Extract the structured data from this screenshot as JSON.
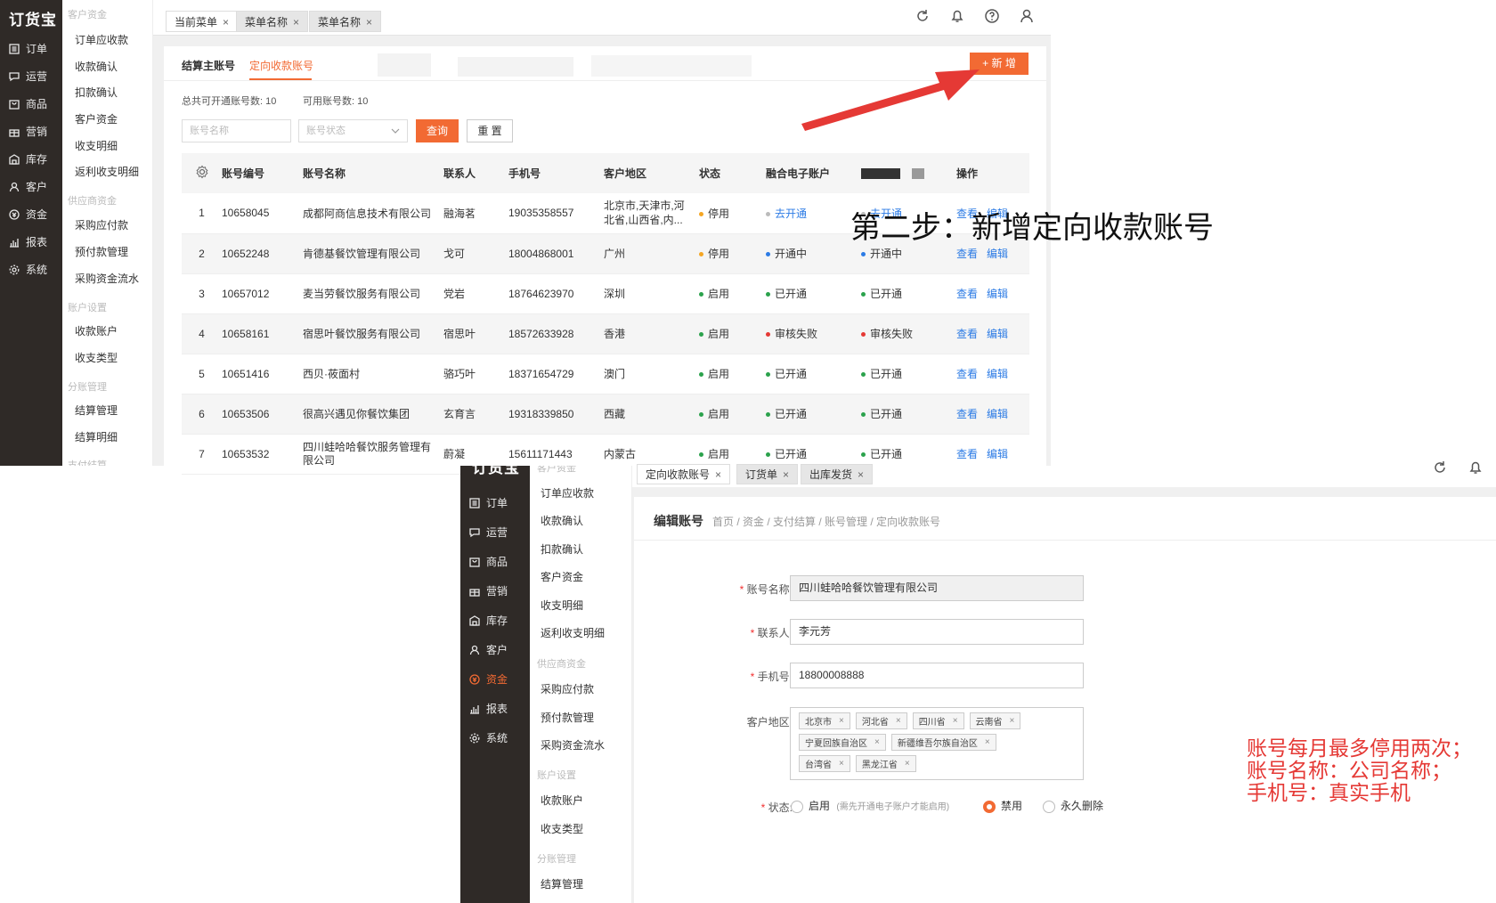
{
  "top": {
    "logo": "订货宝",
    "nav": [
      {
        "label": "订单",
        "icon": "list-icon"
      },
      {
        "label": "运营",
        "icon": "chat-icon"
      },
      {
        "label": "商品",
        "icon": "bag-icon"
      },
      {
        "label": "营销",
        "icon": "gift-icon"
      },
      {
        "label": "库存",
        "icon": "warehouse-icon"
      },
      {
        "label": "客户",
        "icon": "user-icon"
      },
      {
        "label": "资金",
        "icon": "money-icon"
      },
      {
        "label": "报表",
        "icon": "chart-icon"
      },
      {
        "label": "系统",
        "icon": "gear-icon"
      }
    ],
    "subnav": {
      "s1": "客户资金",
      "i1": "订单应收款",
      "i2": "收款确认",
      "i3": "扣款确认",
      "i4": "客户资金",
      "i5": "收支明细",
      "i6": "返利收支明细",
      "s2": "供应商资金",
      "i7": "采购应付款",
      "i8": "预付款管理",
      "i9": "采购资金流水",
      "s3": "账户设置",
      "i10": "收款账户",
      "i11": "收支类型",
      "s4": "分账管理",
      "i12": "结算管理",
      "i13": "结算明细",
      "s5": "支付结算"
    },
    "tabs": [
      "当前菜单",
      "菜单名称",
      "菜单名称"
    ],
    "tab_close": "×",
    "subtabs": {
      "main": "结算主账号",
      "active": "定向收款账号"
    },
    "add_button": "+ 新 增",
    "stats": {
      "total": "总共可开通账号数: 10",
      "available": "可用账号数: 10"
    },
    "filter": {
      "name_placeholder": "账号名称",
      "status_placeholder": "账号状态",
      "query": "查询",
      "reset": "重 置"
    },
    "columns": [
      "账号编号",
      "账号名称",
      "联系人",
      "手机号",
      "客户地区",
      "状态",
      "融合电子账户",
      "操作"
    ],
    "rows": [
      {
        "no": "1",
        "id": "10658045",
        "name": "成都阿商信息技术有限公司",
        "contact": "融海茗",
        "phone": "19035358557",
        "region": "北京市,天津市,河",
        "region2": "北省,山西省,内...",
        "status": "停用",
        "status_color": "#f5a623",
        "fusion": "去开通",
        "fusion_color": "#bbbbbb",
        "ext": "去开通",
        "ext_color": "#bbbbbb",
        "view": "查看",
        "edit": "编辑"
      },
      {
        "no": "2",
        "id": "10652248",
        "name": "肯德基餐饮管理有限公司",
        "contact": "戈可",
        "phone": "18004868001",
        "region": "广州",
        "region2": "",
        "status": "停用",
        "status_color": "#f5a623",
        "fusion": "开通中",
        "fusion_color": "#2c7be5",
        "ext": "开通中",
        "ext_color": "#2c7be5",
        "view": "查看",
        "edit": "编辑"
      },
      {
        "no": "3",
        "id": "10657012",
        "name": "麦当劳餐饮服务有限公司",
        "contact": "党岩",
        "phone": "18764623970",
        "region": "深圳",
        "region2": "",
        "status": "启用",
        "status_color": "#2ba24c",
        "fusion": "已开通",
        "fusion_color": "#2ba24c",
        "ext": "已开通",
        "ext_color": "#2ba24c",
        "view": "查看",
        "edit": "编辑"
      },
      {
        "no": "4",
        "id": "10658161",
        "name": "宿思叶餐饮服务有限公司",
        "contact": "宿思叶",
        "phone": "18572633928",
        "region": "香港",
        "region2": "",
        "status": "启用",
        "status_color": "#2ba24c",
        "fusion": "审核失败",
        "fusion_color": "#e53935",
        "ext": "审核失败",
        "ext_color": "#e53935",
        "view": "查看",
        "edit": "编辑"
      },
      {
        "no": "5",
        "id": "10651416",
        "name": "西贝·莜面村",
        "contact": "骆巧叶",
        "phone": "18371654729",
        "region": "澳门",
        "region2": "",
        "status": "启用",
        "status_color": "#2ba24c",
        "fusion": "已开通",
        "fusion_color": "#2ba24c",
        "ext": "已开通",
        "ext_color": "#2ba24c",
        "view": "查看",
        "edit": "编辑"
      },
      {
        "no": "6",
        "id": "10653506",
        "name": "很高兴遇见你餐饮集团",
        "contact": "玄育言",
        "phone": "19318339850",
        "region": "西藏",
        "region2": "",
        "status": "启用",
        "status_color": "#2ba24c",
        "fusion": "已开通",
        "fusion_color": "#2ba24c",
        "ext": "已开通",
        "ext_color": "#2ba24c",
        "view": "查看",
        "edit": "编辑"
      },
      {
        "no": "7",
        "id": "10653532",
        "name": "四川蛙哈哈餐饮服务管理有",
        "name2": "限公司",
        "contact": "蔚凝",
        "phone": "15611171443",
        "region": "内蒙古",
        "region2": "",
        "status": "启用",
        "status_color": "#2ba24c",
        "fusion": "已开通",
        "fusion_color": "#2ba24c",
        "ext": "已开通",
        "ext_color": "#2ba24c",
        "view": "查看",
        "edit": "编辑"
      }
    ]
  },
  "annotation_top": "第二步：新增定向收款账号",
  "bottom": {
    "logo": "订货宝",
    "nav": [
      {
        "label": "订单",
        "icon": "list-icon"
      },
      {
        "label": "运营",
        "icon": "chat-icon"
      },
      {
        "label": "商品",
        "icon": "bag-icon"
      },
      {
        "label": "营销",
        "icon": "gift-icon"
      },
      {
        "label": "库存",
        "icon": "warehouse-icon"
      },
      {
        "label": "客户",
        "icon": "user-icon"
      },
      {
        "label": "资金",
        "icon": "money-icon"
      },
      {
        "label": "报表",
        "icon": "chart-icon"
      },
      {
        "label": "系统",
        "icon": "gear-icon"
      }
    ],
    "subnav": {
      "s1": "客户资金",
      "i1": "订单应收款",
      "i2": "收款确认",
      "i3": "扣款确认",
      "i4": "客户资金",
      "i5": "收支明细",
      "i6": "返利收支明细",
      "s2": "供应商资金",
      "i7": "采购应付款",
      "i8": "预付款管理",
      "i9": "采购资金流水",
      "s3": "账户设置",
      "i10": "收款账户",
      "i11": "收支类型",
      "s4": "分账管理",
      "i12": "结算管理"
    },
    "tabs": [
      "定向收款账号",
      "订货单",
      "出库发货"
    ],
    "title": "编辑账号",
    "breadcrumb": "首页 / 资金 / 支付结算 / 账号管理 / 定向收款账号",
    "form": {
      "name_label": "账号名称:",
      "name_value": "四川蛙哈哈餐饮管理有限公司",
      "contact_label": "联系人:",
      "contact_value": "李元芳",
      "phone_label": "手机号:",
      "phone_value": "18800008888",
      "region_label": "客户地区:",
      "regions": [
        "北京市",
        "河北省",
        "四川省",
        "云南省",
        "宁夏回族自治区",
        "新疆维吾尔族自治区",
        "台湾省",
        "黑龙江省"
      ],
      "status_label": "状态:",
      "opt_enable": "启用",
      "opt_enable_hint": "(需先开通电子账户才能启用)",
      "opt_disable": "禁用",
      "opt_delete": "永久删除",
      "required_mark": "*"
    }
  },
  "annotation_bottom": [
    "账号每月最多停用两次；",
    "账号名称：公司名称；",
    "手机号：真实手机"
  ],
  "colors": {
    "accent": "#f26a33",
    "nav_bg": "#2f2a27",
    "link": "#2c7be5",
    "annotation_red": "#e53935"
  }
}
